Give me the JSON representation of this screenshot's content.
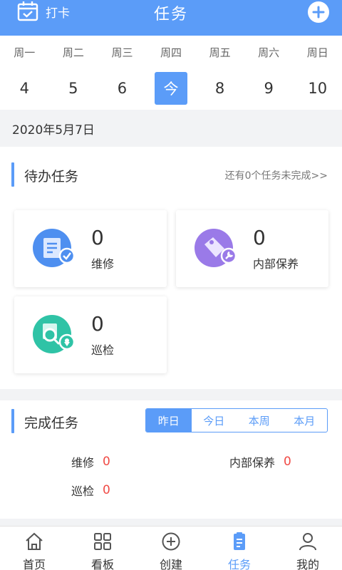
{
  "header": {
    "punch_label": "打卡",
    "title": "任务"
  },
  "week": {
    "days": [
      "周一",
      "周二",
      "周三",
      "周四",
      "周五",
      "周六",
      "周日"
    ],
    "dates": [
      "4",
      "5",
      "6",
      "今",
      "8",
      "9",
      "10"
    ],
    "selected_index": 3
  },
  "date_label": "2020年5月7日",
  "pending": {
    "title": "待办任务",
    "summary_link": "还有0个任务未完成>>",
    "cards": [
      {
        "count": "0",
        "label": "维修",
        "icon": "repair-doc-icon"
      },
      {
        "count": "0",
        "label": "内部保养",
        "icon": "maintenance-tag-icon"
      },
      {
        "count": "0",
        "label": "巡检",
        "icon": "inspection-search-icon"
      }
    ]
  },
  "completed": {
    "title": "完成任务",
    "periods": [
      "昨日",
      "今日",
      "本周",
      "本月"
    ],
    "active_period": "昨日",
    "stats": [
      {
        "label": "维修",
        "value": "0"
      },
      {
        "label": "内部保养",
        "value": "0"
      },
      {
        "label": "巡检",
        "value": "0"
      }
    ]
  },
  "tabs": [
    {
      "label": "首页",
      "icon": "home-icon"
    },
    {
      "label": "看板",
      "icon": "dashboard-grid-icon"
    },
    {
      "label": "创建",
      "icon": "create-plus-icon"
    },
    {
      "label": "任务",
      "icon": "task-clipboard-icon"
    },
    {
      "label": "我的",
      "icon": "user-icon"
    }
  ],
  "active_tab": "任务",
  "colors": {
    "primary": "#5b9cf8",
    "alert_value": "#f04a45",
    "repair_icon": "#4e8ff0",
    "maintenance_icon": "#9a7ae8",
    "inspection_icon": "#2fc3a6"
  }
}
